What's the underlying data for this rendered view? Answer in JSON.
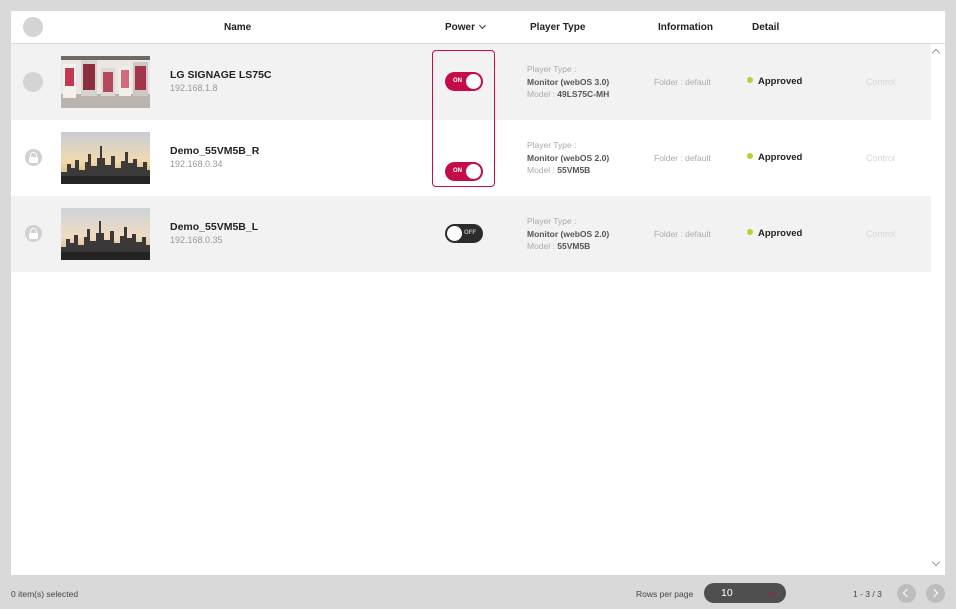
{
  "header": {
    "col_name": "Name",
    "col_power": "Power",
    "col_player_type": "Player Type",
    "col_information": "Information",
    "col_detail": "Detail"
  },
  "devices": [
    {
      "name": "LG SIGNAGE LS75C",
      "ip": "192.168.1.8",
      "power": "ON",
      "player_type_label": "Player Type :",
      "player_type": "Monitor (webOS 3.0)",
      "model_label": "Model :",
      "model": "49LS75C-MH",
      "information": "Folder : default",
      "status": "Approved",
      "control": "Control",
      "locked": false,
      "thumbnail": "store-display"
    },
    {
      "name": "Demo_55VM5B_R",
      "ip": "192.168.0.34",
      "power": "ON",
      "player_type_label": "Player Type :",
      "player_type": "Monitor (webOS 2.0)",
      "model_label": "Model :",
      "model": "55VM5B",
      "information": "Folder : default",
      "status": "Approved",
      "control": "Control",
      "locked": true,
      "thumbnail": "city-skyline"
    },
    {
      "name": "Demo_55VM5B_L",
      "ip": "192.168.0.35",
      "power": "OFF",
      "player_type_label": "Player Type :",
      "player_type": "Monitor (webOS 2.0)",
      "model_label": "Model :",
      "model": "55VM5B",
      "information": "Folder : default",
      "status": "Approved",
      "control": "Control",
      "locked": true,
      "thumbnail": "city-skyline"
    }
  ],
  "footer": {
    "selected_text": "0 item(s) selected",
    "rows_per_page_label": "Rows per page",
    "rows_per_page_value": "10",
    "page_range": "1 - 3 / 3"
  },
  "colors": {
    "accent": "#c40c4b",
    "approved_dot": "#b5d334",
    "toggle_off": "#2b2b2b"
  },
  "icons": [
    "lock-icon",
    "chevron-down-icon",
    "chevron-up-icon",
    "prev-page-icon",
    "next-page-icon"
  ]
}
